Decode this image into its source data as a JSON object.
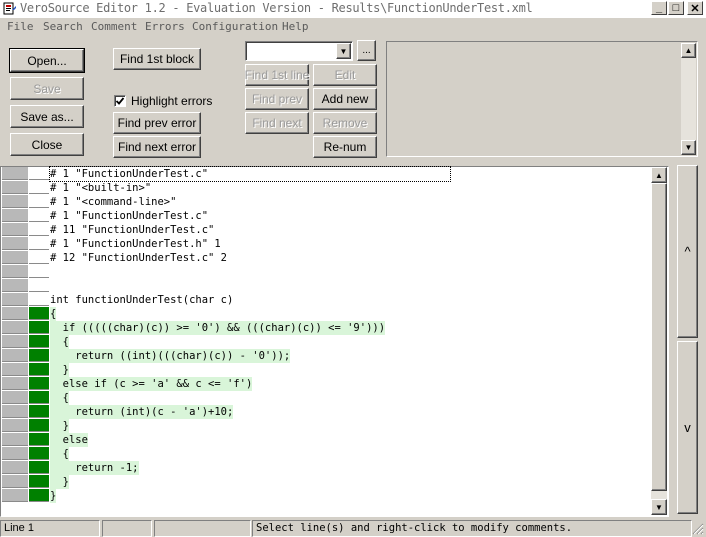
{
  "window": {
    "title": "VeroSource Editor 1.2 - Evaluation Version - Results\\FunctionUnderTest.xml",
    "minimize": "_",
    "maximize": "□",
    "close": "✕"
  },
  "menu": [
    "File",
    "Search",
    "Comment",
    "Errors",
    "Configuration",
    "Help"
  ],
  "toolbar": {
    "open": "Open...",
    "save": "Save",
    "save_as": "Save as...",
    "close": "Close",
    "find_1st_block": "Find 1st block",
    "highlight_errors": "Highlight errors",
    "highlight_checked": true,
    "find_prev_error": "Find prev error",
    "find_next_error": "Find next error",
    "combo_value": "",
    "combo_more": "...",
    "find_1st_line": "Find 1st line",
    "edit": "Edit",
    "find_prev": "Find prev",
    "add_new": "Add new",
    "find_next": "Find next",
    "remove": "Remove",
    "renum": "Re-num"
  },
  "editor": {
    "lines": [
      {
        "text": "# 1 \"FunctionUnderTest.c\"",
        "marked": false
      },
      {
        "text": "# 1 \"<built-in>\"",
        "marked": false
      },
      {
        "text": "# 1 \"<command-line>\"",
        "marked": false
      },
      {
        "text": "# 1 \"FunctionUnderTest.c\"",
        "marked": false
      },
      {
        "text": "# 11 \"FunctionUnderTest.c\"",
        "marked": false
      },
      {
        "text": "# 1 \"FunctionUnderTest.h\" 1",
        "marked": false
      },
      {
        "text": "# 12 \"FunctionUnderTest.c\" 2",
        "marked": false
      },
      {
        "text": "",
        "marked": false
      },
      {
        "text": "",
        "marked": false
      },
      {
        "text": "int functionUnderTest(char c)",
        "marked": false
      },
      {
        "text": "{",
        "marked": true
      },
      {
        "text": "  if (((((char)(c)) >= '0') && (((char)(c)) <= '9')))",
        "marked": true
      },
      {
        "text": "  {",
        "marked": true
      },
      {
        "text": "    return ((int)(((char)(c)) - '0'));",
        "marked": true
      },
      {
        "text": "  }",
        "marked": true
      },
      {
        "text": "  else if (c >= 'a' && c <= 'f')",
        "marked": true
      },
      {
        "text": "  {",
        "marked": true
      },
      {
        "text": "    return (int)(c - 'a')+10;",
        "marked": true
      },
      {
        "text": "  }",
        "marked": true
      },
      {
        "text": "  else",
        "marked": true
      },
      {
        "text": "  {",
        "marked": true
      },
      {
        "text": "    return -1;",
        "marked": true
      },
      {
        "text": "  }",
        "marked": true
      },
      {
        "text": "}",
        "marked": true
      }
    ],
    "scroll_up": "▲",
    "scroll_down": "▼",
    "nav_up": "^",
    "nav_down": "v"
  },
  "status": {
    "line": "Line 1",
    "message": "Select line(s) and right-click to modify comments."
  }
}
